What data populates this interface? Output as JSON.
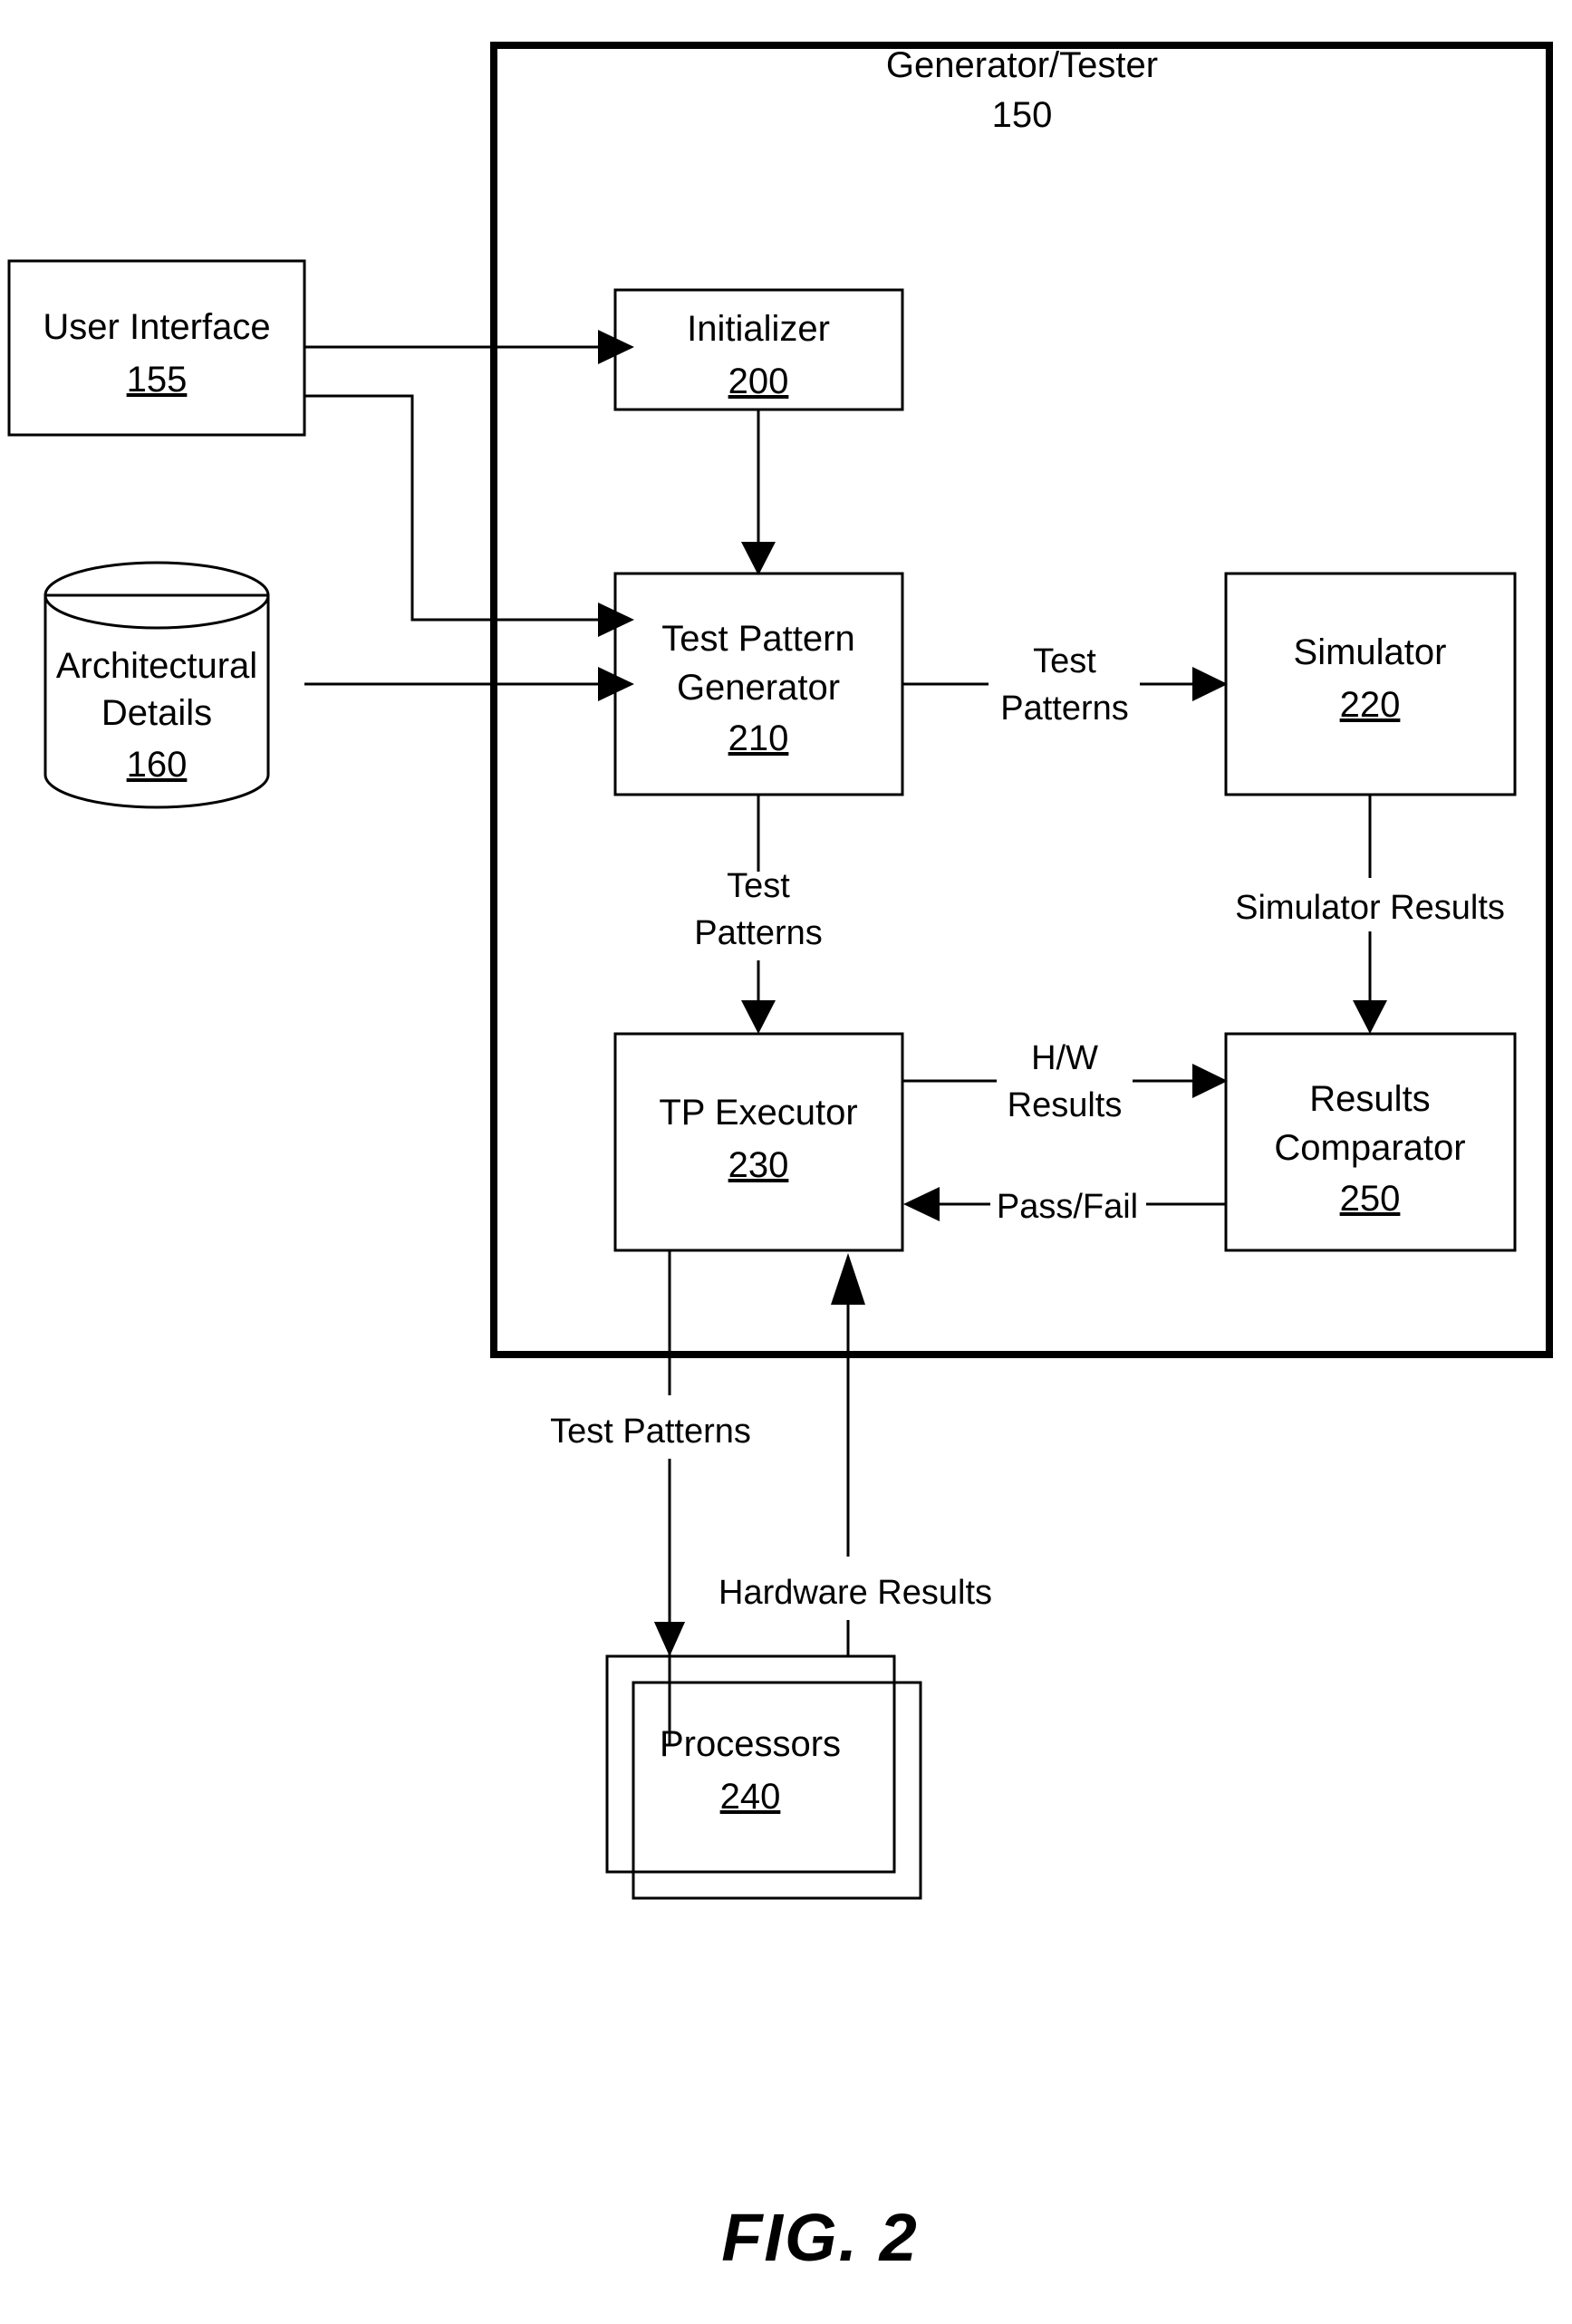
{
  "figure": {
    "caption": "FIG. 2"
  },
  "container": {
    "title": "Generator/Tester",
    "ref": "150"
  },
  "nodes": [
    {
      "id": "user-interface",
      "label": "User Interface",
      "ref": "155",
      "shape": "rect"
    },
    {
      "id": "architectural-details",
      "label_line1": "Architectural",
      "label_line2": "Details",
      "ref": "160",
      "shape": "cylinder"
    },
    {
      "id": "initializer",
      "label": "Initializer",
      "ref": "200",
      "shape": "rect"
    },
    {
      "id": "test-pattern-generator",
      "label_line1": "Test Pattern",
      "label_line2": "Generator",
      "ref": "210",
      "shape": "rect"
    },
    {
      "id": "simulator",
      "label": "Simulator",
      "ref": "220",
      "shape": "rect"
    },
    {
      "id": "tp-executor",
      "label": "TP Executor",
      "ref": "230",
      "shape": "rect"
    },
    {
      "id": "processors",
      "label": "Processors",
      "ref": "240",
      "shape": "stacked-rect"
    },
    {
      "id": "results-comparator",
      "label_line1": "Results",
      "label_line2": "Comparator",
      "ref": "250",
      "shape": "rect"
    }
  ],
  "edges": [
    {
      "id": "ui-to-initializer",
      "label": "",
      "from": "user-interface",
      "to": "initializer"
    },
    {
      "id": "ui-to-tpg",
      "label": "",
      "from": "user-interface",
      "to": "test-pattern-generator"
    },
    {
      "id": "arch-to-tpg",
      "label": "",
      "from": "architectural-details",
      "to": "test-pattern-generator"
    },
    {
      "id": "initializer-to-tpg",
      "label": "",
      "from": "initializer",
      "to": "test-pattern-generator"
    },
    {
      "id": "tpg-to-simulator",
      "label_line1": "Test",
      "label_line2": "Patterns",
      "from": "test-pattern-generator",
      "to": "simulator"
    },
    {
      "id": "tpg-to-executor",
      "label_line1": "Test",
      "label_line2": "Patterns",
      "from": "test-pattern-generator",
      "to": "tp-executor"
    },
    {
      "id": "simulator-to-comparator",
      "label": "Simulator Results",
      "from": "simulator",
      "to": "results-comparator"
    },
    {
      "id": "executor-to-comparator",
      "label_line1": "H/W",
      "label_line2": "Results",
      "from": "tp-executor",
      "to": "results-comparator"
    },
    {
      "id": "comparator-to-executor",
      "label": "Pass/Fail",
      "from": "results-comparator",
      "to": "tp-executor"
    },
    {
      "id": "executor-to-processors",
      "label": "Test Patterns",
      "from": "tp-executor",
      "to": "processors"
    },
    {
      "id": "processors-to-executor",
      "label": "Hardware Results",
      "from": "processors",
      "to": "tp-executor"
    }
  ],
  "colors": {
    "stroke": "#000000",
    "fill": "#ffffff",
    "background": "#ffffff"
  }
}
